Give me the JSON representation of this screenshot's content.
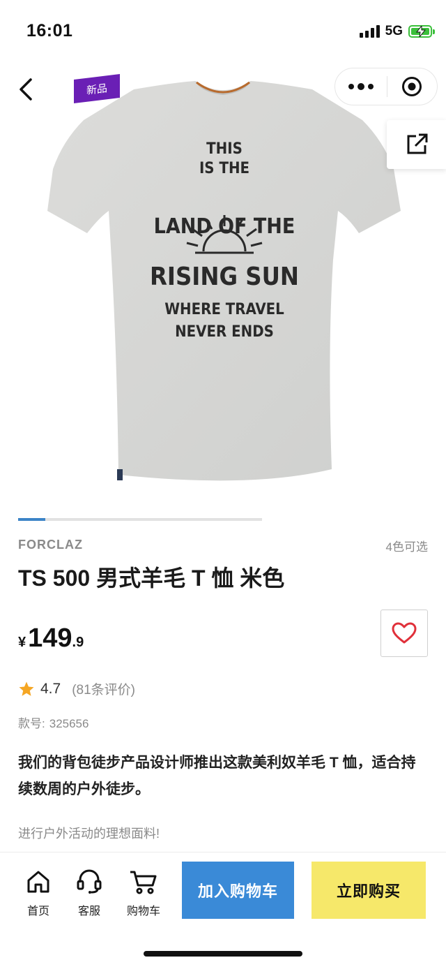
{
  "status_bar": {
    "time": "16:01",
    "network": "5G"
  },
  "header": {
    "badge": "新品"
  },
  "gallery": {
    "progress": 0.11,
    "print_lines": [
      "THIS",
      "IS THE",
      "LAND OF THE",
      "RISING SUN",
      "WHERE TRAVEL",
      "NEVER ENDS"
    ]
  },
  "product": {
    "brand": "FORCLAZ",
    "colors_available": "4色可选",
    "title": "TS 500 男式羊毛 T 恤 米色",
    "price": {
      "currency": "¥",
      "integer": "149",
      "decimal": ".9"
    },
    "rating": {
      "score": "4.7",
      "reviews": "(81条评价)",
      "stars": 1
    },
    "sku": {
      "label": "款号:",
      "number": "325656"
    },
    "description": "我们的背包徒步产品设计师推出这款美利奴羊毛 T 恤，适合持续数周的户外徒步。",
    "sub_description": "进行户外活动的理想面料!"
  },
  "bottom_bar": {
    "nav": [
      {
        "label": "首页",
        "icon": "home-icon"
      },
      {
        "label": "客服",
        "icon": "headset-icon"
      },
      {
        "label": "购物车",
        "icon": "cart-icon"
      }
    ],
    "add_to_cart": "加入购物车",
    "buy_now": "立即购买"
  },
  "colors": {
    "badge": "#6a1fb5",
    "progress": "#3c84c7",
    "cart_button": "#3a8ad7",
    "buy_button": "#f6e86a",
    "favorite": "#e0303a",
    "star": "#f5a623",
    "battery": "#3bbf3b"
  }
}
